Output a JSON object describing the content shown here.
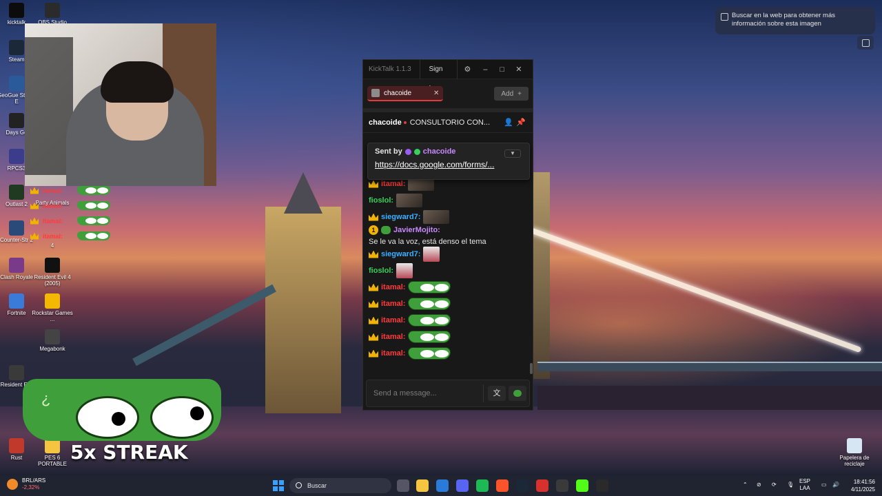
{
  "desktop": {
    "icons_left": [
      {
        "label": "kicktalk",
        "color": "#0c0c0c"
      },
      {
        "label": "Steam",
        "color": "#1b2838"
      },
      {
        "label": "GeoGue Steam E",
        "color": "#2a5a9a"
      },
      {
        "label": "Days Go",
        "color": "#222222"
      },
      {
        "label": "RPCS3",
        "color": "#3b3c8c"
      },
      {
        "label": "Outlast 2",
        "color": "#1f3a20"
      },
      {
        "label": "Counter-Str 2",
        "color": "#2a4a7a"
      },
      {
        "label": "Clash Royale",
        "color": "#7a3a8a"
      },
      {
        "label": "Fortnite",
        "color": "#3a7ad9"
      },
      {
        "label": "Resident Evil",
        "color": "#3a3a3a"
      },
      {
        "label": "Rust",
        "color": "#c0392b"
      }
    ],
    "icons_col2": [
      {
        "label": "OBS Studio",
        "color": "#2b2b2b"
      },
      {
        "label": "Resident Evil 4 (2005)",
        "color": "#111111"
      },
      {
        "label": "Rockstar Games ...",
        "color": "#f5b800"
      },
      {
        "label": "Megabonk",
        "color": "#444444"
      },
      {
        "label": "PES 6 PORTABLE",
        "color": "#f5c542"
      }
    ],
    "partial_label_1": "Party Animals",
    "partial_label_2": "4",
    "recycle_bin": "Papelera de reciclaje"
  },
  "overlay": {
    "mini_users": [
      "itamal:",
      "itamal:",
      "itamal:",
      "itamal:"
    ],
    "streak_text": "5x STREAK",
    "streak_glyph": "¿"
  },
  "kicktalk": {
    "app_title": "KickTalk 1.1.3",
    "sign_in": "Sign In",
    "gear_icon": "⚙",
    "minimize": "–",
    "maximize": "□",
    "close": "✕",
    "tab_name": "chacoide",
    "tab_close": "✕",
    "add_label": "Add",
    "add_icon": "+",
    "channel": "chacoide",
    "stream_title": "CONSULTORIO CON...",
    "pinned": {
      "sent_by": "Sent by",
      "user": "chacoide",
      "link": "https://docs.google.com/forms/..."
    },
    "messages": [
      {
        "user": "itamal:",
        "color": "#ff3b3b",
        "badge": "crown",
        "emote": "img",
        "text": ""
      },
      {
        "user": "fioslol:",
        "color": "#35d15a",
        "badge": "",
        "emote": "img",
        "text": ""
      },
      {
        "user": "siegward7:",
        "color": "#3ab0ff",
        "badge": "crown",
        "emote": "img",
        "text": ""
      },
      {
        "user": "JavierMojito:",
        "color": "#c889ff",
        "badge": "num",
        "emote": "",
        "text": "Se le va la voz, está denso el tema"
      },
      {
        "user": "siegward7:",
        "color": "#3ab0ff",
        "badge": "crown",
        "emote": "hat",
        "text": ""
      },
      {
        "user": "fioslol:",
        "color": "#35d15a",
        "badge": "",
        "emote": "hat",
        "text": ""
      },
      {
        "user": "itamal:",
        "color": "#ff3b3b",
        "badge": "crown",
        "emote": "frog",
        "text": ""
      },
      {
        "user": "itamal:",
        "color": "#ff3b3b",
        "badge": "crown",
        "emote": "frog",
        "text": ""
      },
      {
        "user": "itamal:",
        "color": "#ff3b3b",
        "badge": "crown",
        "emote": "frog",
        "text": ""
      },
      {
        "user": "itamal:",
        "color": "#ff3b3b",
        "badge": "crown",
        "emote": "frog",
        "text": ""
      },
      {
        "user": "itamal:",
        "color": "#ff3b3b",
        "badge": "crown",
        "emote": "frog",
        "text": ""
      }
    ],
    "num_badge": "1",
    "input_placeholder": "Send a message...",
    "translate_icon": "文"
  },
  "lens": {
    "text": "Buscar en la web para obtener más información sobre esta imagen"
  },
  "taskbar": {
    "ticker": "BRL/ARS",
    "change": "-2,32%",
    "search": "Buscar",
    "apps": [
      {
        "name": "file-explorer-icon",
        "color": "#f5c542"
      },
      {
        "name": "bing-icon",
        "color": "#2a7ad9"
      },
      {
        "name": "discord-icon",
        "color": "#5865f2"
      },
      {
        "name": "spotify-icon",
        "color": "#1db954"
      },
      {
        "name": "brave-icon",
        "color": "#fb542b"
      },
      {
        "name": "steam-icon",
        "color": "#1b2838"
      },
      {
        "name": "voice-mod-icon",
        "color": "#d6312c"
      },
      {
        "name": "obs-icon",
        "color": "#3a3a3a"
      },
      {
        "name": "kick-icon",
        "color": "#53fc18"
      },
      {
        "name": "epic-icon",
        "color": "#2a2a2a"
      }
    ],
    "lang_top": "ESP",
    "lang_bottom": "LAA",
    "time": "18:41:56",
    "date": "4/11/2025"
  }
}
